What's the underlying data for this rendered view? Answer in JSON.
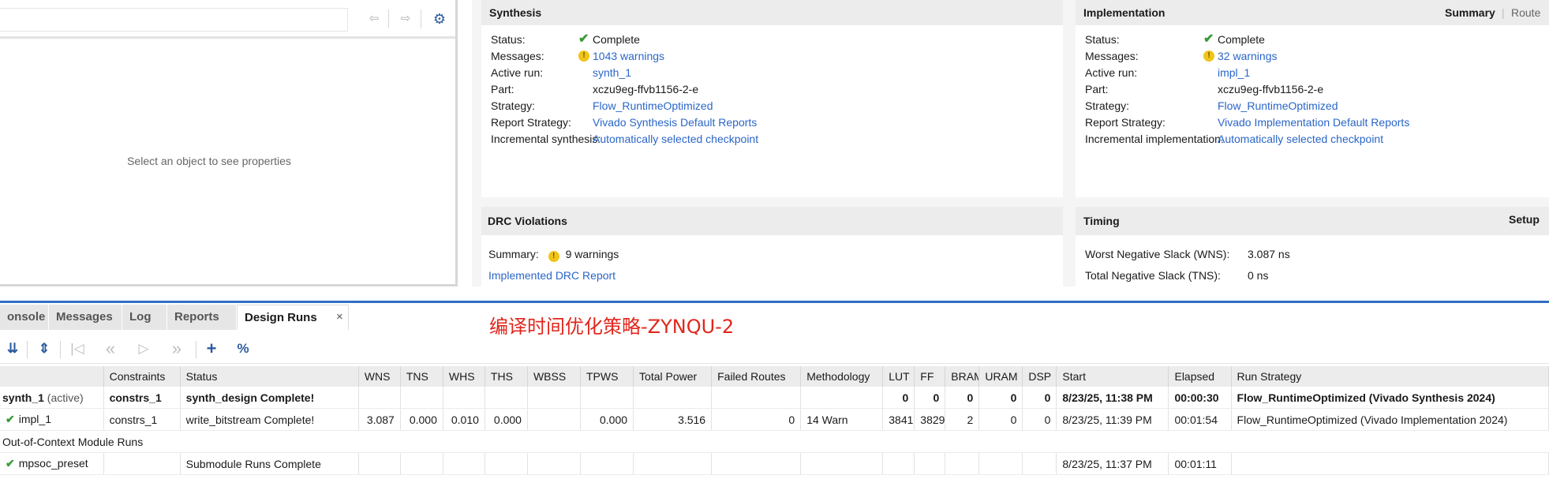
{
  "properties": {
    "empty_message": "Select an object to see properties",
    "nav_back": "⇦",
    "nav_forward": "⇨",
    "settings": "⚙"
  },
  "synthesis": {
    "title": "Synthesis",
    "rows": [
      {
        "label": "Status:",
        "value": "Complete",
        "icon": "check",
        "link": false
      },
      {
        "label": "Messages:",
        "value": "1043 warnings",
        "icon": "warning",
        "link": true
      },
      {
        "label": "Active run:",
        "value": "synth_1",
        "icon": "",
        "link": true
      },
      {
        "label": "Part:",
        "value": "xczu9eg-ffvb1156-2-e",
        "icon": "",
        "link": false
      },
      {
        "label": "Strategy:",
        "value": "Flow_RuntimeOptimized",
        "icon": "",
        "link": true
      },
      {
        "label": "Report Strategy:",
        "value": "Vivado Synthesis Default Reports",
        "icon": "",
        "link": true
      },
      {
        "label": "Incremental synthesis:",
        "value": "Automatically selected checkpoint",
        "icon": "",
        "link": true
      }
    ]
  },
  "implementation": {
    "title": "Implementation",
    "summary_label": "Summary",
    "route_label": "Route",
    "rows": [
      {
        "label": "Status:",
        "value": "Complete",
        "icon": "check",
        "link": false
      },
      {
        "label": "Messages:",
        "value": "32 warnings",
        "icon": "warning",
        "link": true
      },
      {
        "label": "Active run:",
        "value": "impl_1",
        "icon": "",
        "link": true
      },
      {
        "label": "Part:",
        "value": "xczu9eg-ffvb1156-2-e",
        "icon": "",
        "link": false
      },
      {
        "label": "Strategy:",
        "value": "Flow_RuntimeOptimized",
        "icon": "",
        "link": true
      },
      {
        "label": "Report Strategy:",
        "value": "Vivado Implementation Default Reports",
        "icon": "",
        "link": true
      },
      {
        "label": "Incremental implementation:",
        "value": "Automatically selected checkpoint",
        "icon": "",
        "link": true
      }
    ]
  },
  "drc": {
    "title": "DRC Violations",
    "summary_label": "Summary:",
    "summary_value": "9 warnings",
    "report_link": "Implemented DRC Report"
  },
  "timing": {
    "title": "Timing",
    "setup_label": "Setup",
    "wns_label": "Worst Negative Slack (WNS):",
    "wns_value": "3.087 ns",
    "tns_label": "Total Negative Slack (TNS):",
    "tns_value": "0 ns"
  },
  "tabs": {
    "console": "onsole",
    "messages": "Messages",
    "log": "Log",
    "reports": "Reports",
    "design_runs": "Design Runs",
    "close": "×"
  },
  "annotation": "编译时间优化策略-ZYNQU-2",
  "toolbar": {
    "collapse_all": "⇊",
    "expand_all": "⇕",
    "first": "|◁",
    "previous": "«",
    "run": "▷",
    "next": "»",
    "add": "+",
    "percent": "%"
  },
  "table": {
    "columns": [
      "",
      "Constraints",
      "Status",
      "WNS",
      "TNS",
      "WHS",
      "THS",
      "WBSS",
      "TPWS",
      "Total Power",
      "Failed Routes",
      "Methodology",
      "LUT",
      "FF",
      "BRAM",
      "URAM",
      "DSP",
      "Start",
      "Elapsed",
      "Run Strategy"
    ],
    "rows": [
      {
        "name": "synth_1",
        "tag": "(active)",
        "check": false,
        "bold": true,
        "cells": [
          "constrs_1",
          "synth_design Complete!",
          "",
          "",
          "",
          "",
          "",
          "",
          "",
          "",
          "",
          "0",
          "0",
          "0",
          "0",
          "0",
          "8/23/25, 11:38 PM",
          "00:00:30",
          "Flow_RuntimeOptimized (Vivado Synthesis 2024)"
        ]
      },
      {
        "name": "impl_1",
        "tag": "",
        "check": true,
        "bold": false,
        "cells": [
          "constrs_1",
          "write_bitstream Complete!",
          "3.087",
          "0.000",
          "0.010",
          "0.000",
          "",
          "0.000",
          "3.516",
          "0",
          "14 Warn",
          "3841",
          "3829",
          "2",
          "0",
          "0",
          "8/23/25, 11:39 PM",
          "00:01:54",
          "Flow_RuntimeOptimized (Vivado Implementation 2024)"
        ]
      }
    ],
    "ooc_label": "Out-of-Context Module Runs",
    "submodule": {
      "name": "mpsoc_preset",
      "status": "Submodule Runs Complete",
      "start": "8/23/25, 11:37 PM",
      "elapsed": "00:01:11"
    }
  }
}
